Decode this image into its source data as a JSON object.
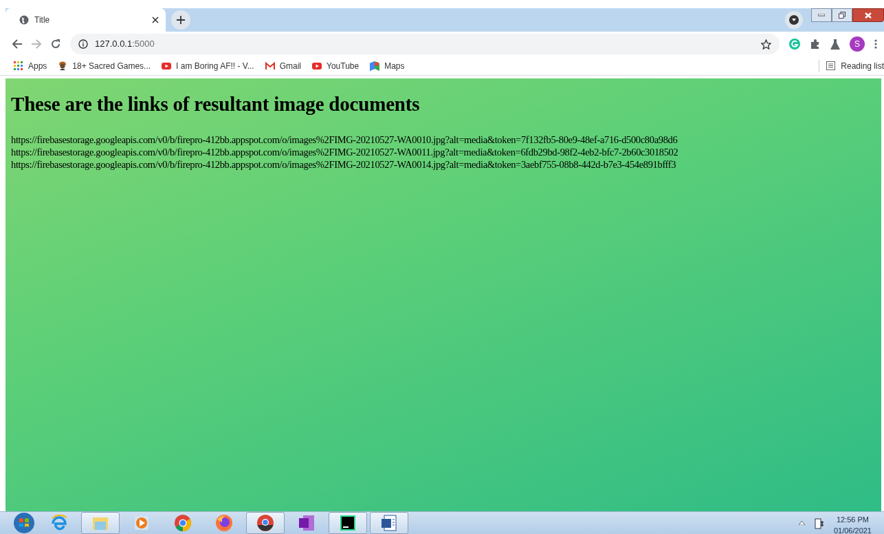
{
  "tab": {
    "title": "Title",
    "selected": true
  },
  "address": {
    "host": "127.0.0.1",
    "port": ":5000"
  },
  "profile": {
    "initial": "S"
  },
  "bookmarks": [
    {
      "label": "Apps",
      "kind": "apps"
    },
    {
      "label": "18+ Sacred Games...",
      "kind": "person"
    },
    {
      "label": "I am Boring AF!! - V...",
      "kind": "video"
    },
    {
      "label": "Gmail",
      "kind": "mail"
    },
    {
      "label": "YouTube",
      "kind": "video"
    },
    {
      "label": "Maps",
      "kind": "map"
    }
  ],
  "reading_list": "Reading list",
  "page": {
    "heading": "These are the links of resultant image documents",
    "links": [
      "https://firebasestorage.googleapis.com/v0/b/firepro-412bb.appspot.com/o/images%2FIMG-20210527-WA0010.jpg?alt=media&token=7f132fb5-80e9-48ef-a716-d500c80a98d6",
      "https://firebasestorage.googleapis.com/v0/b/firepro-412bb.appspot.com/o/images%2FIMG-20210527-WA0011.jpg?alt=media&token=6fdb29bd-98f2-4eb2-bfc7-2b60c3018502",
      "https://firebasestorage.googleapis.com/v0/b/firepro-412bb.appspot.com/o/images%2FIMG-20210527-WA0014.jpg?alt=media&token=3aebf755-08b8-442d-b7e3-454e891bfff3"
    ]
  },
  "taskbar": {
    "apps": [
      {
        "kind": "ie",
        "running": false
      },
      {
        "kind": "folder",
        "running": true
      },
      {
        "kind": "player",
        "running": false
      },
      {
        "kind": "chrome",
        "running": false
      },
      {
        "kind": "firefox",
        "running": false
      },
      {
        "kind": "chromebeta",
        "running": true
      },
      {
        "kind": "notes",
        "running": false
      },
      {
        "kind": "ide",
        "running": true
      },
      {
        "kind": "doc",
        "running": true
      }
    ],
    "time": "12:56 PM",
    "date": "01/06/2021"
  }
}
